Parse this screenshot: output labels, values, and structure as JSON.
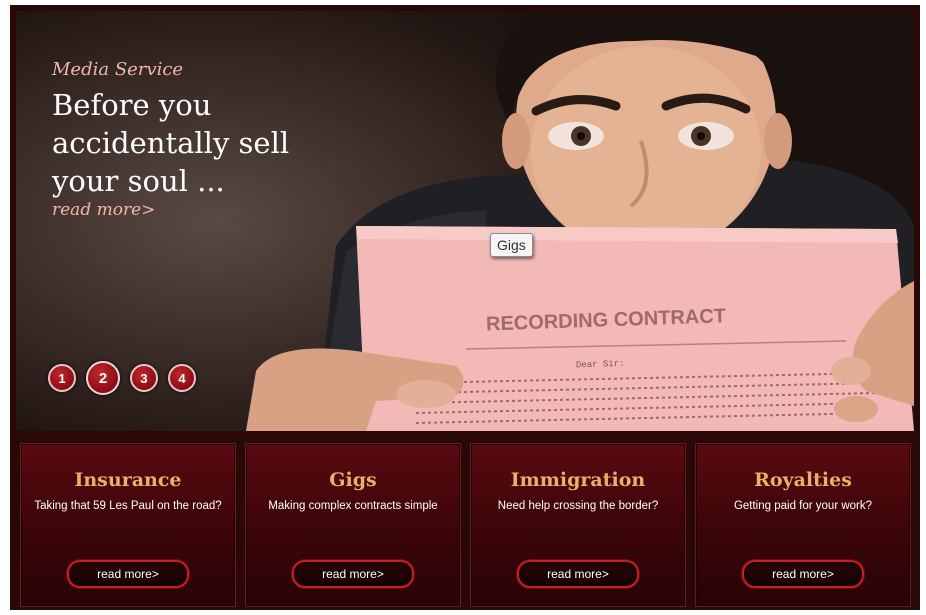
{
  "hero": {
    "kicker": "Media Service",
    "headline": "Before you accidentally sell your soul ...",
    "read_more": "read more>",
    "contract_heading": "RECORDING CONTRACT",
    "contract_salutation": "Dear Sir:",
    "pager": [
      "1",
      "2",
      "3",
      "4"
    ],
    "active_page": "2",
    "tooltip": "Gigs"
  },
  "cards": [
    {
      "title": "Insurance",
      "description": "Taking that 59 Les Paul on the road?",
      "button": "read more>"
    },
    {
      "title": "Gigs",
      "description": "Making complex contracts simple",
      "button": "read more>"
    },
    {
      "title": "Immigration",
      "description": "Need help crossing the border?",
      "button": "read more>"
    },
    {
      "title": "Royalties",
      "description": "Getting paid for your work?",
      "button": "read more>"
    }
  ],
  "colors": {
    "frame": "#2b0808",
    "accent_title": "#e9b06a",
    "kicker": "#f0b7a9",
    "button_border": "#c51f25"
  }
}
